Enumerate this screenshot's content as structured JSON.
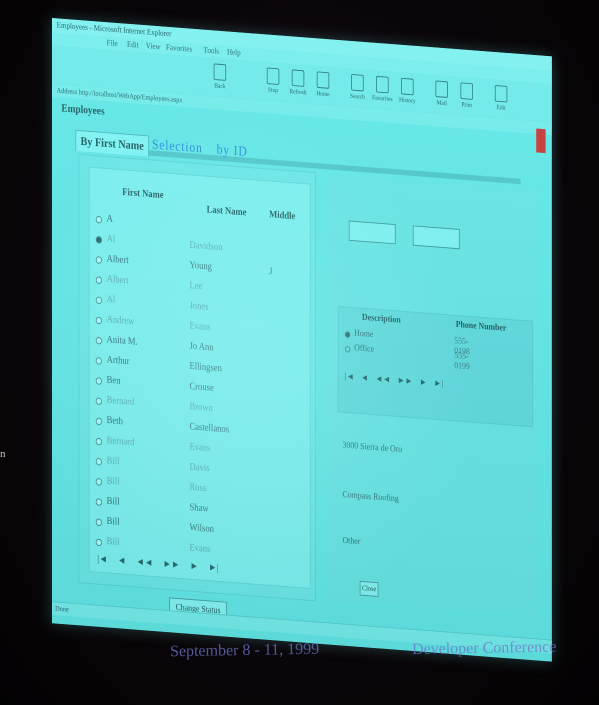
{
  "room": {
    "side_mark": "n"
  },
  "window": {
    "title": "Employees - Microsoft Internet Explorer",
    "menu": [
      "File",
      "Edit",
      "View",
      "Favorites",
      "Tools",
      "Help"
    ],
    "toolbar": [
      {
        "label": "Back",
        "icon": "back-arrow-icon"
      },
      {
        "label": "Stop",
        "icon": "stop-icon"
      },
      {
        "label": "Refresh",
        "icon": "refresh-icon"
      },
      {
        "label": "Home",
        "icon": "home-icon"
      },
      {
        "label": "Search",
        "icon": "search-icon"
      },
      {
        "label": "Favorites",
        "icon": "favorites-icon"
      },
      {
        "label": "History",
        "icon": "history-icon"
      },
      {
        "label": "Mail",
        "icon": "mail-icon"
      },
      {
        "label": "Print",
        "icon": "print-icon"
      },
      {
        "label": "Edit",
        "icon": "edit-icon"
      }
    ],
    "address": "Address  http://localhost/WebApp/Employees.aspx",
    "status": "Done"
  },
  "page": {
    "title": "Employees",
    "tab": "By First Name",
    "heading_left": "Selection",
    "heading_right": "by ID"
  },
  "employee_grid": {
    "col_first": "First Name",
    "col_last": "Last Name",
    "col_middle": "Middle",
    "rows": [
      {
        "first": "A",
        "last": "",
        "middle": "",
        "selected": false,
        "dim": false
      },
      {
        "first": "Al",
        "last": "Davidson",
        "middle": "",
        "selected": true,
        "dim": true
      },
      {
        "first": "Albert",
        "last": "Young",
        "middle": "J",
        "selected": false,
        "dim": false
      },
      {
        "first": "Albert",
        "last": "Lee",
        "middle": "",
        "selected": false,
        "dim": true
      },
      {
        "first": "Al",
        "last": "Jones",
        "middle": "",
        "selected": false,
        "dim": true
      },
      {
        "first": "Andrew",
        "last": "Evans",
        "middle": "",
        "selected": false,
        "dim": true
      },
      {
        "first": "Anita M.",
        "last": "Jo Ann",
        "middle": "",
        "selected": false,
        "dim": false
      },
      {
        "first": "Arthur",
        "last": "Ellingsen",
        "middle": "",
        "selected": false,
        "dim": false
      },
      {
        "first": "Ben",
        "last": "Crouse",
        "middle": "",
        "selected": false,
        "dim": false
      },
      {
        "first": "Bernard",
        "last": "Brown",
        "middle": "",
        "selected": false,
        "dim": true
      },
      {
        "first": "Beth",
        "last": "Castellanos",
        "middle": "",
        "selected": false,
        "dim": false
      },
      {
        "first": "Bernard",
        "last": "Evans",
        "middle": "",
        "selected": false,
        "dim": true
      },
      {
        "first": "Bill",
        "last": "Davis",
        "middle": "",
        "selected": false,
        "dim": true
      },
      {
        "first": "Bill",
        "last": "Ross",
        "middle": "",
        "selected": false,
        "dim": true
      },
      {
        "first": "Bill",
        "last": "Shaw",
        "middle": "",
        "selected": false,
        "dim": false
      },
      {
        "first": "Bill",
        "last": "Wilson",
        "middle": "",
        "selected": false,
        "dim": false
      },
      {
        "first": "Bill",
        "last": "Evans",
        "middle": "",
        "selected": false,
        "dim": true
      }
    ],
    "nav": "|◄ ◄ ◄◄ ►► ► ►|"
  },
  "buttons": {
    "change_status": "Change Status",
    "close": "Close"
  },
  "phones": {
    "col_desc": "Description",
    "col_num": "Phone Number",
    "rows": [
      {
        "desc": "Home",
        "num": "555-0198",
        "selected": true
      },
      {
        "desc": "Office",
        "num": "555-0199",
        "selected": false
      }
    ],
    "nav": "|◄ ◄ ◄◄ ►► ► ►|"
  },
  "details": {
    "address": "3000 Sierra de Oro",
    "company": "Compass Roofing",
    "other": "Other"
  },
  "caption": {
    "left": "September 8 - 11, 1999",
    "right": "Developer Conference"
  }
}
